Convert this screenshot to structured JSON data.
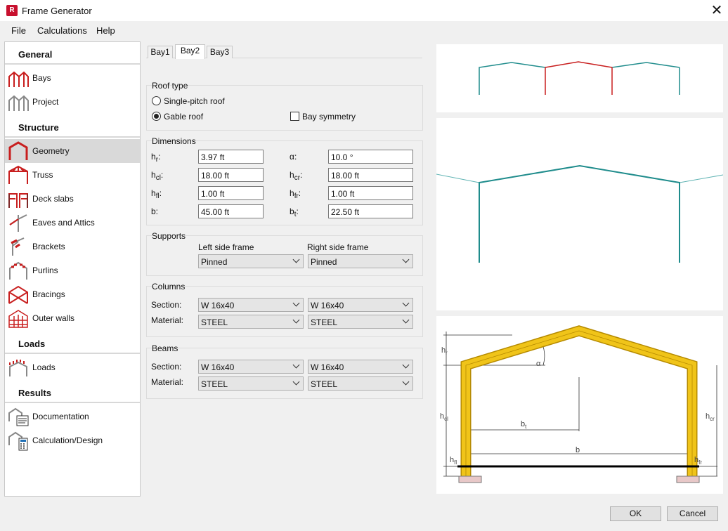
{
  "window": {
    "title": "Frame Generator"
  },
  "menu": [
    "File",
    "Calculations",
    "Help"
  ],
  "sidebar": {
    "general": "General",
    "structure": "Structure",
    "loads_head": "Loads",
    "results": "Results",
    "items": [
      "Bays",
      "Project",
      "Geometry",
      "Truss",
      "Deck slabs",
      "Eaves and Attics",
      "Brackets",
      "Purlins",
      "Bracings",
      "Outer walls",
      "Loads",
      "Documentation",
      "Calculation/Design"
    ]
  },
  "tabs": [
    "Bay1",
    "Bay2",
    "Bay3"
  ],
  "roof": {
    "label": "Roof type",
    "single": "Single-pitch roof",
    "gable": "Gable roof",
    "symmetry": "Bay symmetry"
  },
  "dimensions": {
    "label": "Dimensions",
    "hr": {
      "l": "h",
      "s": "r",
      "v": "3.97 ft"
    },
    "alpha": {
      "l": "α:",
      "v": "10.0 °"
    },
    "hcl": {
      "l": "h",
      "s": "cl",
      "v": "18.00 ft"
    },
    "hcr": {
      "l": "h",
      "s": "cr",
      "v": "18.00 ft"
    },
    "hfl": {
      "l": "h",
      "s": "fl",
      "v": "1.00 ft"
    },
    "hfr": {
      "l": "h",
      "s": "fr",
      "v": "1.00 ft"
    },
    "b": {
      "l": "b:",
      "v": "45.00 ft"
    },
    "bt": {
      "l": "b",
      "s": "t",
      "v": "22.50 ft"
    }
  },
  "supports": {
    "label": "Supports",
    "left_head": "Left side frame",
    "right_head": "Right side frame",
    "left": "Pinned",
    "right": "Pinned"
  },
  "columns": {
    "label": "Columns",
    "section": "Section:",
    "material": "Material:",
    "sec_l": "W 16x40",
    "sec_r": "W 16x40",
    "mat_l": "STEEL",
    "mat_r": "STEEL"
  },
  "beams": {
    "label": "Beams",
    "section": "Section:",
    "material": "Material:",
    "sec_l": "W 16x40",
    "sec_r": "W 16x40",
    "mat_l": "STEEL",
    "mat_r": "STEEL"
  },
  "diagram": {
    "hr": "h",
    "hr_s": "r",
    "alpha": "α",
    "hcl": "h",
    "hcl_s": "cl",
    "hcr": "h",
    "hcr_s": "cr",
    "bt": "b",
    "bt_s": "t",
    "b": "b",
    "hfl": "h",
    "hfl_s": "fl",
    "hfr": "h",
    "hfr_s": "fr"
  },
  "buttons": {
    "ok": "OK",
    "cancel": "Cancel"
  },
  "colors": {
    "teal": "#1f8c8c",
    "red": "#c81e1e",
    "beam": "#f0c419"
  }
}
